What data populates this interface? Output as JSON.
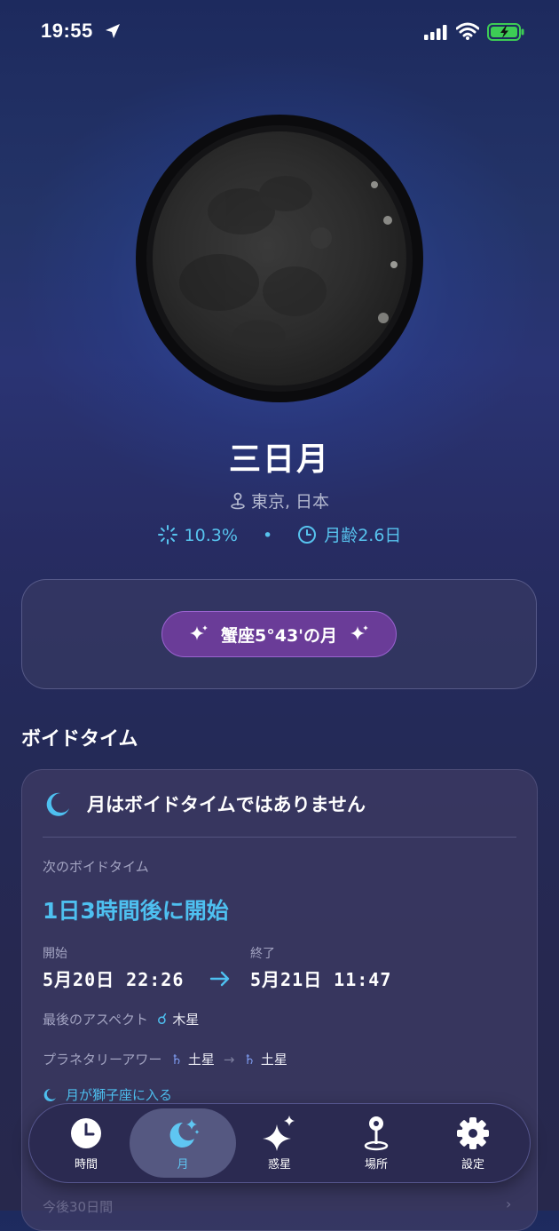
{
  "status_bar": {
    "time": "19:55"
  },
  "moon": {
    "phase_name": "三日月",
    "location": "東京, 日本",
    "illumination": "10.3%",
    "separator": "•",
    "age": "月齢2.6日"
  },
  "zodiac": {
    "label": "蟹座5°43'の月"
  },
  "void_section": {
    "title": "ボイドタイム",
    "status": "月はボイドタイムではありません",
    "next_label": "次のボイドタイム",
    "countdown": "1日3時間後に開始",
    "start_label": "開始",
    "start_value": "5月20日 22:26",
    "end_label": "終了",
    "end_value": "5月21日 11:47",
    "last_aspect_label": "最後のアスペクト",
    "last_aspect_symbol": "☌",
    "last_aspect_value": "木星",
    "planetary_hour_label": "プラネタリーアワー",
    "planetary_hour_from_symbol": "♄",
    "planetary_hour_from": "土星",
    "planetary_hour_arrow": "→",
    "planetary_hour_to_symbol": "♄",
    "planetary_hour_to": "土星",
    "moon_enters": "月が獅子座に入る",
    "faded_more": "今後30日間",
    "faded_arrow": "›"
  },
  "tabs": [
    {
      "label": "時間",
      "icon": "clock-icon"
    },
    {
      "label": "月",
      "icon": "moon-stars-icon",
      "active": true
    },
    {
      "label": "惑星",
      "icon": "sparkles-icon"
    },
    {
      "label": "場所",
      "icon": "map-pin-icon"
    },
    {
      "label": "設定",
      "icon": "gear-icon"
    }
  ],
  "colors": {
    "accent_cyan": "#4ec0f0",
    "pill_purple": "#6a3c98",
    "background_top": "#1d2a5e",
    "background_bottom": "#27284c"
  }
}
